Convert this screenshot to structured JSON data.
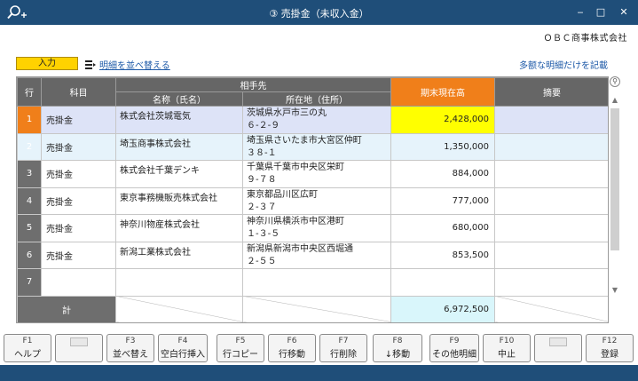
{
  "window": {
    "title": "③ 売掛金（未収入金）",
    "minimize": "‒",
    "maximize": "□",
    "close": "✕"
  },
  "company": "ＯＢＣ商事株式会社",
  "toolbar": {
    "mode": "入力",
    "sort_link": "明細を並べ替える",
    "multi_link": "多额な明細だけを記載"
  },
  "grid": {
    "headers": {
      "row": "行",
      "subject": "科目",
      "partner_group": "相手先",
      "name": "名称（氏名）",
      "address": "所在地（住所）",
      "amount": "期末現在高",
      "memo": "摘要"
    },
    "rows": [
      {
        "no": "1",
        "subject": "売掛金",
        "name": "株式会社茨城電気",
        "address1": "茨城県水戸市三の丸",
        "address2": "６-２-９",
        "amount": "2,428,000",
        "memo": ""
      },
      {
        "no": "2",
        "subject": "売掛金",
        "name": "埼玉商事株式会社",
        "address1": "埼玉県さいたま市大宮区仲町",
        "address2": "３８-１",
        "amount": "1,350,000",
        "memo": ""
      },
      {
        "no": "3",
        "subject": "売掛金",
        "name": "株式会社千葉デンキ",
        "address1": "千葉県千葉市中央区栄町",
        "address2": "９-７８",
        "amount": "884,000",
        "memo": ""
      },
      {
        "no": "4",
        "subject": "売掛金",
        "name": "東京事務機販売株式会社",
        "address1": "東京都品川区広町",
        "address2": "２-３７",
        "amount": "777,000",
        "memo": ""
      },
      {
        "no": "5",
        "subject": "売掛金",
        "name": "神奈川物産株式会社",
        "address1": "神奈川県横浜市中区港町",
        "address2": "１-３-５",
        "amount": "680,000",
        "memo": ""
      },
      {
        "no": "6",
        "subject": "売掛金",
        "name": "新潟工業株式会社",
        "address1": "新潟県新潟市中央区西堀通",
        "address2": "２-５５",
        "amount": "853,500",
        "memo": ""
      },
      {
        "no": "7",
        "subject": "",
        "name": "",
        "address1": "",
        "address2": "",
        "amount": "",
        "memo": ""
      }
    ],
    "total_label": "計",
    "total_amount": "6,972,500"
  },
  "fkeys": [
    {
      "num": "F1",
      "label": "ヘルプ"
    },
    {
      "num": "",
      "label": ""
    },
    {
      "num": "F3",
      "label": "並べ替え"
    },
    {
      "num": "F4",
      "label": "空白行挿入"
    },
    {
      "num": "F5",
      "label": "行コピー"
    },
    {
      "num": "F6",
      "label": "行移動"
    },
    {
      "num": "F7",
      "label": "行削除"
    },
    {
      "num": "F8",
      "label": "↓移動"
    },
    {
      "num": "F9",
      "label": "その他明細"
    },
    {
      "num": "F10",
      "label": "中止"
    },
    {
      "num": "",
      "label": ""
    },
    {
      "num": "F12",
      "label": "登録"
    }
  ],
  "colors": {
    "titlebar": "#1f4e79",
    "accent_orange": "#f07f1a",
    "mode_yellow": "#ffd200",
    "current_row": "#dde3f7",
    "highlight_amount": "#ffff00",
    "total_cell": "#d9f6fb",
    "link": "#1e5aa8"
  }
}
